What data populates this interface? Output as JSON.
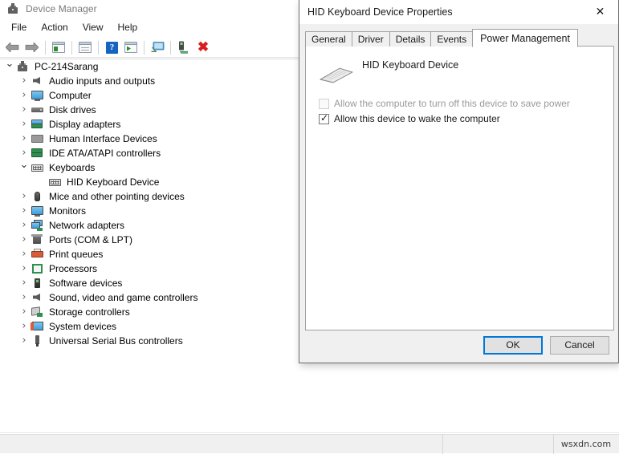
{
  "app": {
    "title": "Device Manager",
    "title_icon": "device-manager-icon",
    "menu": [
      {
        "label": "File"
      },
      {
        "label": "Action"
      },
      {
        "label": "View"
      },
      {
        "label": "Help"
      }
    ],
    "toolbar": [
      {
        "name": "back-arrow-icon",
        "type": "arrow-left"
      },
      {
        "name": "forward-arrow-icon",
        "type": "arrow-right"
      },
      {
        "name": "separator-1",
        "type": "separator"
      },
      {
        "name": "properties-icon",
        "type": "window-green"
      },
      {
        "name": "separator-2",
        "type": "separator"
      },
      {
        "name": "show-details-icon",
        "type": "window-lines"
      },
      {
        "name": "separator-3",
        "type": "separator"
      },
      {
        "name": "help-icon",
        "type": "help",
        "glyph": "?"
      },
      {
        "name": "update-driver-icon",
        "type": "window-play"
      },
      {
        "name": "separator-4",
        "type": "separator"
      },
      {
        "name": "scan-hardware-changes-icon",
        "type": "monitor-scan"
      },
      {
        "name": "separator-5",
        "type": "separator"
      },
      {
        "name": "enable-device-icon",
        "type": "scan-device"
      },
      {
        "name": "uninstall-device-icon",
        "type": "red-x",
        "glyph": "✖"
      }
    ]
  },
  "tree": [
    {
      "label": "PC-214Sarang",
      "indent": 0,
      "chevron": "down",
      "icon": "computer-root-icon"
    },
    {
      "label": "Audio inputs and outputs",
      "indent": 1,
      "chevron": "right",
      "icon": "speaker-icon"
    },
    {
      "label": "Computer",
      "indent": 1,
      "chevron": "right",
      "icon": "monitor-icon"
    },
    {
      "label": "Disk drives",
      "indent": 1,
      "chevron": "right",
      "icon": "disk-drive-icon"
    },
    {
      "label": "Display adapters",
      "indent": 1,
      "chevron": "right",
      "icon": "display-adapter-icon"
    },
    {
      "label": "Human Interface Devices",
      "indent": 1,
      "chevron": "right",
      "icon": "hid-icon"
    },
    {
      "label": "IDE ATA/ATAPI controllers",
      "indent": 1,
      "chevron": "right",
      "icon": "ide-controller-icon"
    },
    {
      "label": "Keyboards",
      "indent": 1,
      "chevron": "down",
      "icon": "keyboard-icon"
    },
    {
      "label": "HID Keyboard Device",
      "indent": 2,
      "chevron": "none",
      "icon": "keyboard-icon"
    },
    {
      "label": "Mice and other pointing devices",
      "indent": 1,
      "chevron": "right",
      "icon": "mouse-icon"
    },
    {
      "label": "Monitors",
      "indent": 1,
      "chevron": "right",
      "icon": "monitor-icon"
    },
    {
      "label": "Network adapters",
      "indent": 1,
      "chevron": "right",
      "icon": "network-adapter-icon"
    },
    {
      "label": "Ports (COM & LPT)",
      "indent": 1,
      "chevron": "right",
      "icon": "port-icon"
    },
    {
      "label": "Print queues",
      "indent": 1,
      "chevron": "right",
      "icon": "printer-icon"
    },
    {
      "label": "Processors",
      "indent": 1,
      "chevron": "right",
      "icon": "processor-icon"
    },
    {
      "label": "Software devices",
      "indent": 1,
      "chevron": "right",
      "icon": "software-device-icon"
    },
    {
      "label": "Sound, video and game controllers",
      "indent": 1,
      "chevron": "right",
      "icon": "speaker-icon"
    },
    {
      "label": "Storage controllers",
      "indent": 1,
      "chevron": "right",
      "icon": "storage-controller-icon"
    },
    {
      "label": "System devices",
      "indent": 1,
      "chevron": "right",
      "icon": "system-device-icon"
    },
    {
      "label": "Universal Serial Bus controllers",
      "indent": 1,
      "chevron": "right",
      "icon": "usb-icon"
    }
  ],
  "status_bar": {
    "cell_1": "",
    "cell_2": "",
    "watermark": "wsxdn.com"
  },
  "dialog": {
    "title": "HID Keyboard Device Properties",
    "close_glyph": "✕",
    "tabs": [
      {
        "label": "General",
        "selected": false
      },
      {
        "label": "Driver",
        "selected": false
      },
      {
        "label": "Details",
        "selected": false
      },
      {
        "label": "Events",
        "selected": false
      },
      {
        "label": "Power Management",
        "selected": true
      }
    ],
    "device_name": "HID Keyboard Device",
    "device_icon": "keyboard-3d-icon",
    "checkboxes": [
      {
        "label": "Allow the computer to turn off this device to save power",
        "checked": false,
        "disabled": true,
        "check_glyph": ""
      },
      {
        "label": "Allow this device to wake the computer",
        "checked": true,
        "disabled": false,
        "check_glyph": "✓"
      }
    ],
    "buttons": [
      {
        "label": "OK",
        "default": true
      },
      {
        "label": "Cancel",
        "default": false
      }
    ]
  },
  "colors": {
    "accent": "#0078d7",
    "window_bg": "#ffffff",
    "dialog_bg": "#f0f0f0",
    "status_bg": "#f0f0f0",
    "danger": "#d81e1e",
    "disabled_text": "#9a9a9a"
  }
}
